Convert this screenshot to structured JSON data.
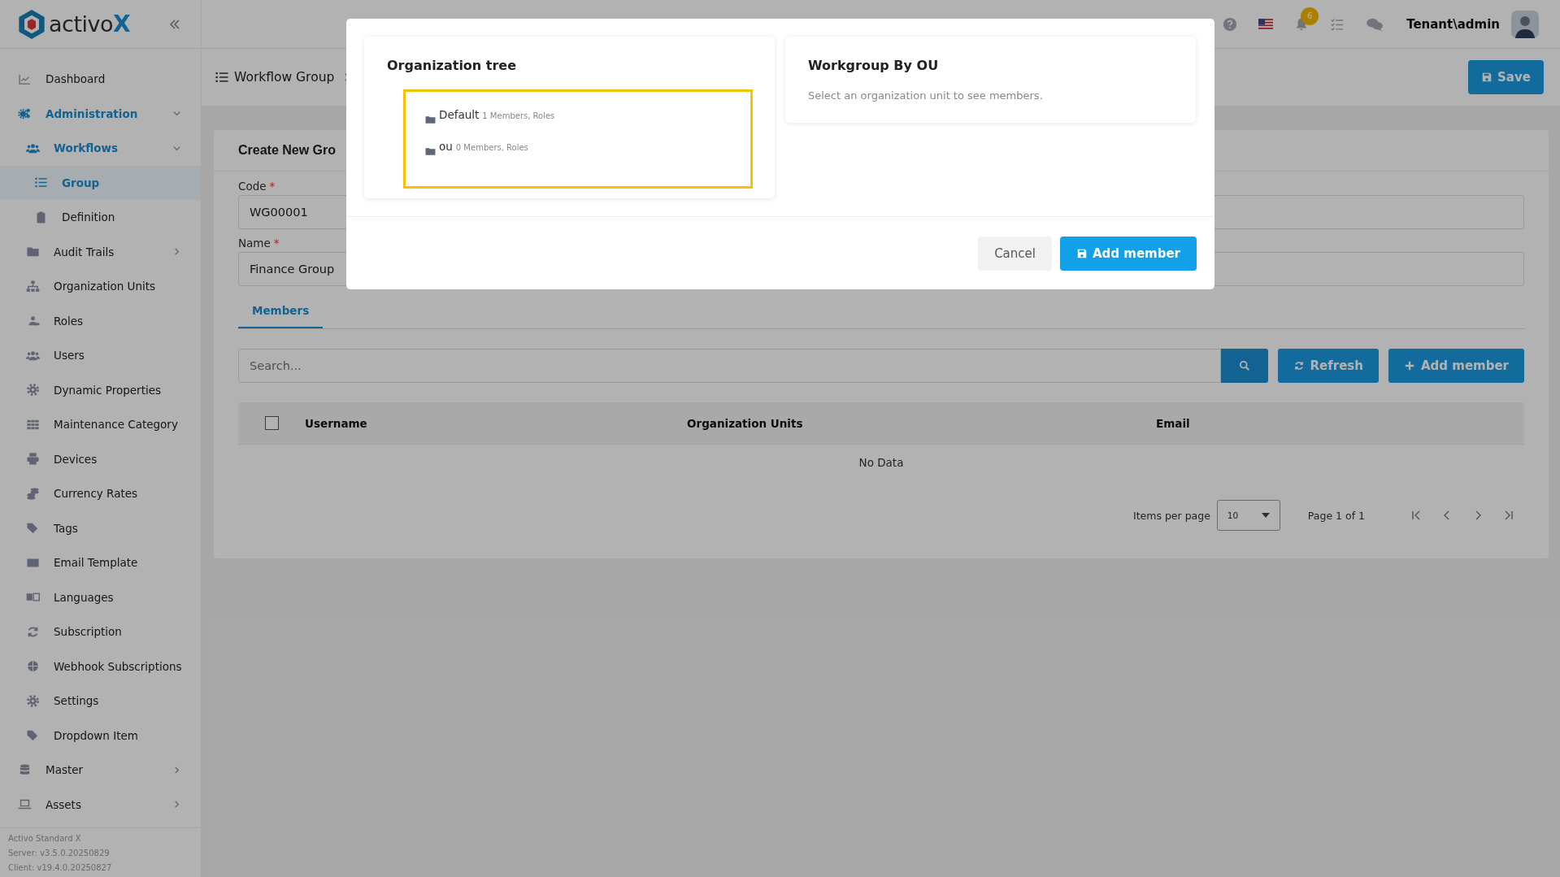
{
  "logo": {
    "text": "activo",
    "accent": "X"
  },
  "sidebar": {
    "items": [
      {
        "label": "Dashboard",
        "selected": false
      },
      {
        "label": "Administration",
        "selected": false,
        "expanded": true,
        "children": [
          {
            "label": "Workflows",
            "selected": false,
            "expanded": true,
            "children": [
              {
                "label": "Group",
                "selected": true
              },
              {
                "label": "Definition",
                "selected": false
              }
            ]
          },
          {
            "label": "Audit Trails",
            "selected": false,
            "expanded": false
          },
          {
            "label": "Organization Units",
            "selected": false
          },
          {
            "label": "Roles",
            "selected": false
          },
          {
            "label": "Users",
            "selected": false
          },
          {
            "label": "Dynamic Properties",
            "selected": false
          },
          {
            "label": "Maintenance Category",
            "selected": false
          },
          {
            "label": "Devices",
            "selected": false
          },
          {
            "label": "Currency Rates",
            "selected": false
          },
          {
            "label": "Tags",
            "selected": false
          },
          {
            "label": "Email Template",
            "selected": false
          },
          {
            "label": "Languages",
            "selected": false
          },
          {
            "label": "Subscription",
            "selected": false
          },
          {
            "label": "Webhook Subscriptions",
            "selected": false
          },
          {
            "label": "Settings",
            "selected": false
          },
          {
            "label": "Dropdown Item",
            "selected": false
          }
        ]
      },
      {
        "label": "Master",
        "selected": false,
        "expanded": false
      },
      {
        "label": "Assets",
        "selected": false,
        "expanded": false
      }
    ],
    "footer": [
      "Activo Standard X",
      "Server: v3.5.0.20250829",
      "Client: v19.4.0.20250827"
    ]
  },
  "topbar": {
    "notification_count": "6",
    "user": "Tenant\\admin"
  },
  "breadcrumb": {
    "title": "Workflow Group"
  },
  "save_button": "Save",
  "form": {
    "title": "Create New Gro",
    "fields": [
      {
        "label": "Code",
        "required_mark": "*",
        "value": "WG00001"
      },
      {
        "label": "Name",
        "required_mark": "*",
        "value": "Finance Group"
      }
    ],
    "tabs": [
      {
        "label": "Members",
        "selected": true
      }
    ],
    "search": {
      "placeholder": "Search..."
    },
    "buttons": [
      {
        "label": "Refresh",
        "kind": "refresh"
      },
      {
        "label": "Add member",
        "kind": "add"
      }
    ],
    "table": {
      "select_all": {
        "checked": false
      },
      "columns": [
        "Username",
        "Organization Units",
        "Email"
      ],
      "empty": "No Data"
    },
    "pagination": {
      "label": "Items per page",
      "per_page": "10",
      "page": "Page 1 of 1"
    }
  },
  "modal": {
    "tree": {
      "title": "Organization tree",
      "focused": true,
      "nodes": [
        {
          "name": "Default",
          "info": "1 Members, Roles"
        },
        {
          "name": "ou",
          "info": "0 Members, Roles"
        }
      ]
    },
    "panel": {
      "title": "Workgroup By OU",
      "hint": "Select an organization unit to see members."
    },
    "buttons": [
      {
        "label": "Cancel",
        "kind": "secondary"
      },
      {
        "label": "Add member",
        "kind": "primary"
      }
    ]
  }
}
